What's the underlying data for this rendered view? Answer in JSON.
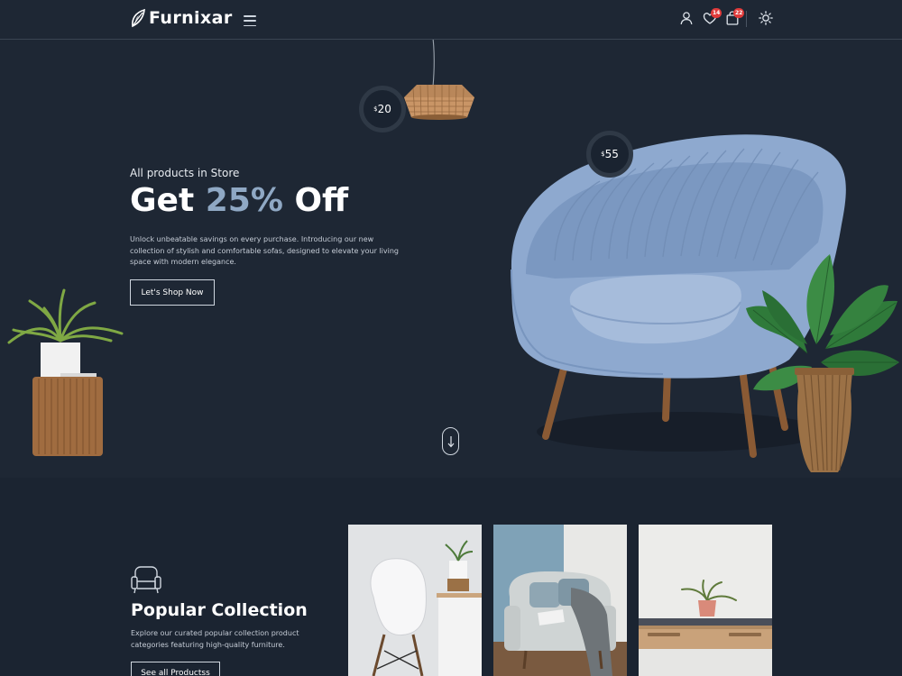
{
  "header": {
    "logo_text": "Furnixar",
    "wishlist_count": "14",
    "cart_count": "22"
  },
  "hero": {
    "subtitle": "All products in Store",
    "title_prefix": "Get",
    "title_highlight": "25%",
    "title_suffix": "Off",
    "description": "Unlock unbeatable savings on every purchase. Introducing our new collection of stylish and comfortable sofas, designed to elevate your living space with modern elegance.",
    "button_label": "Let's Shop Now",
    "price_lamp": "20",
    "price_chair": "55",
    "currency_symbol": "$"
  },
  "collection": {
    "title": "Popular Collection",
    "description": "Explore our curated popular collection product categories featuring high-quality furniture.",
    "button_label": "See all Productss"
  },
  "colors": {
    "background": "#1e2734",
    "accent_highlight": "#8fa8c4",
    "badge": "#e03a3a",
    "chair_blue": "#8ea9cf"
  },
  "icons": [
    "leaf-logo-icon",
    "menu-icon",
    "user-icon",
    "heart-icon",
    "bag-icon",
    "sun-icon",
    "arrow-down-icon",
    "armchair-icon"
  ]
}
